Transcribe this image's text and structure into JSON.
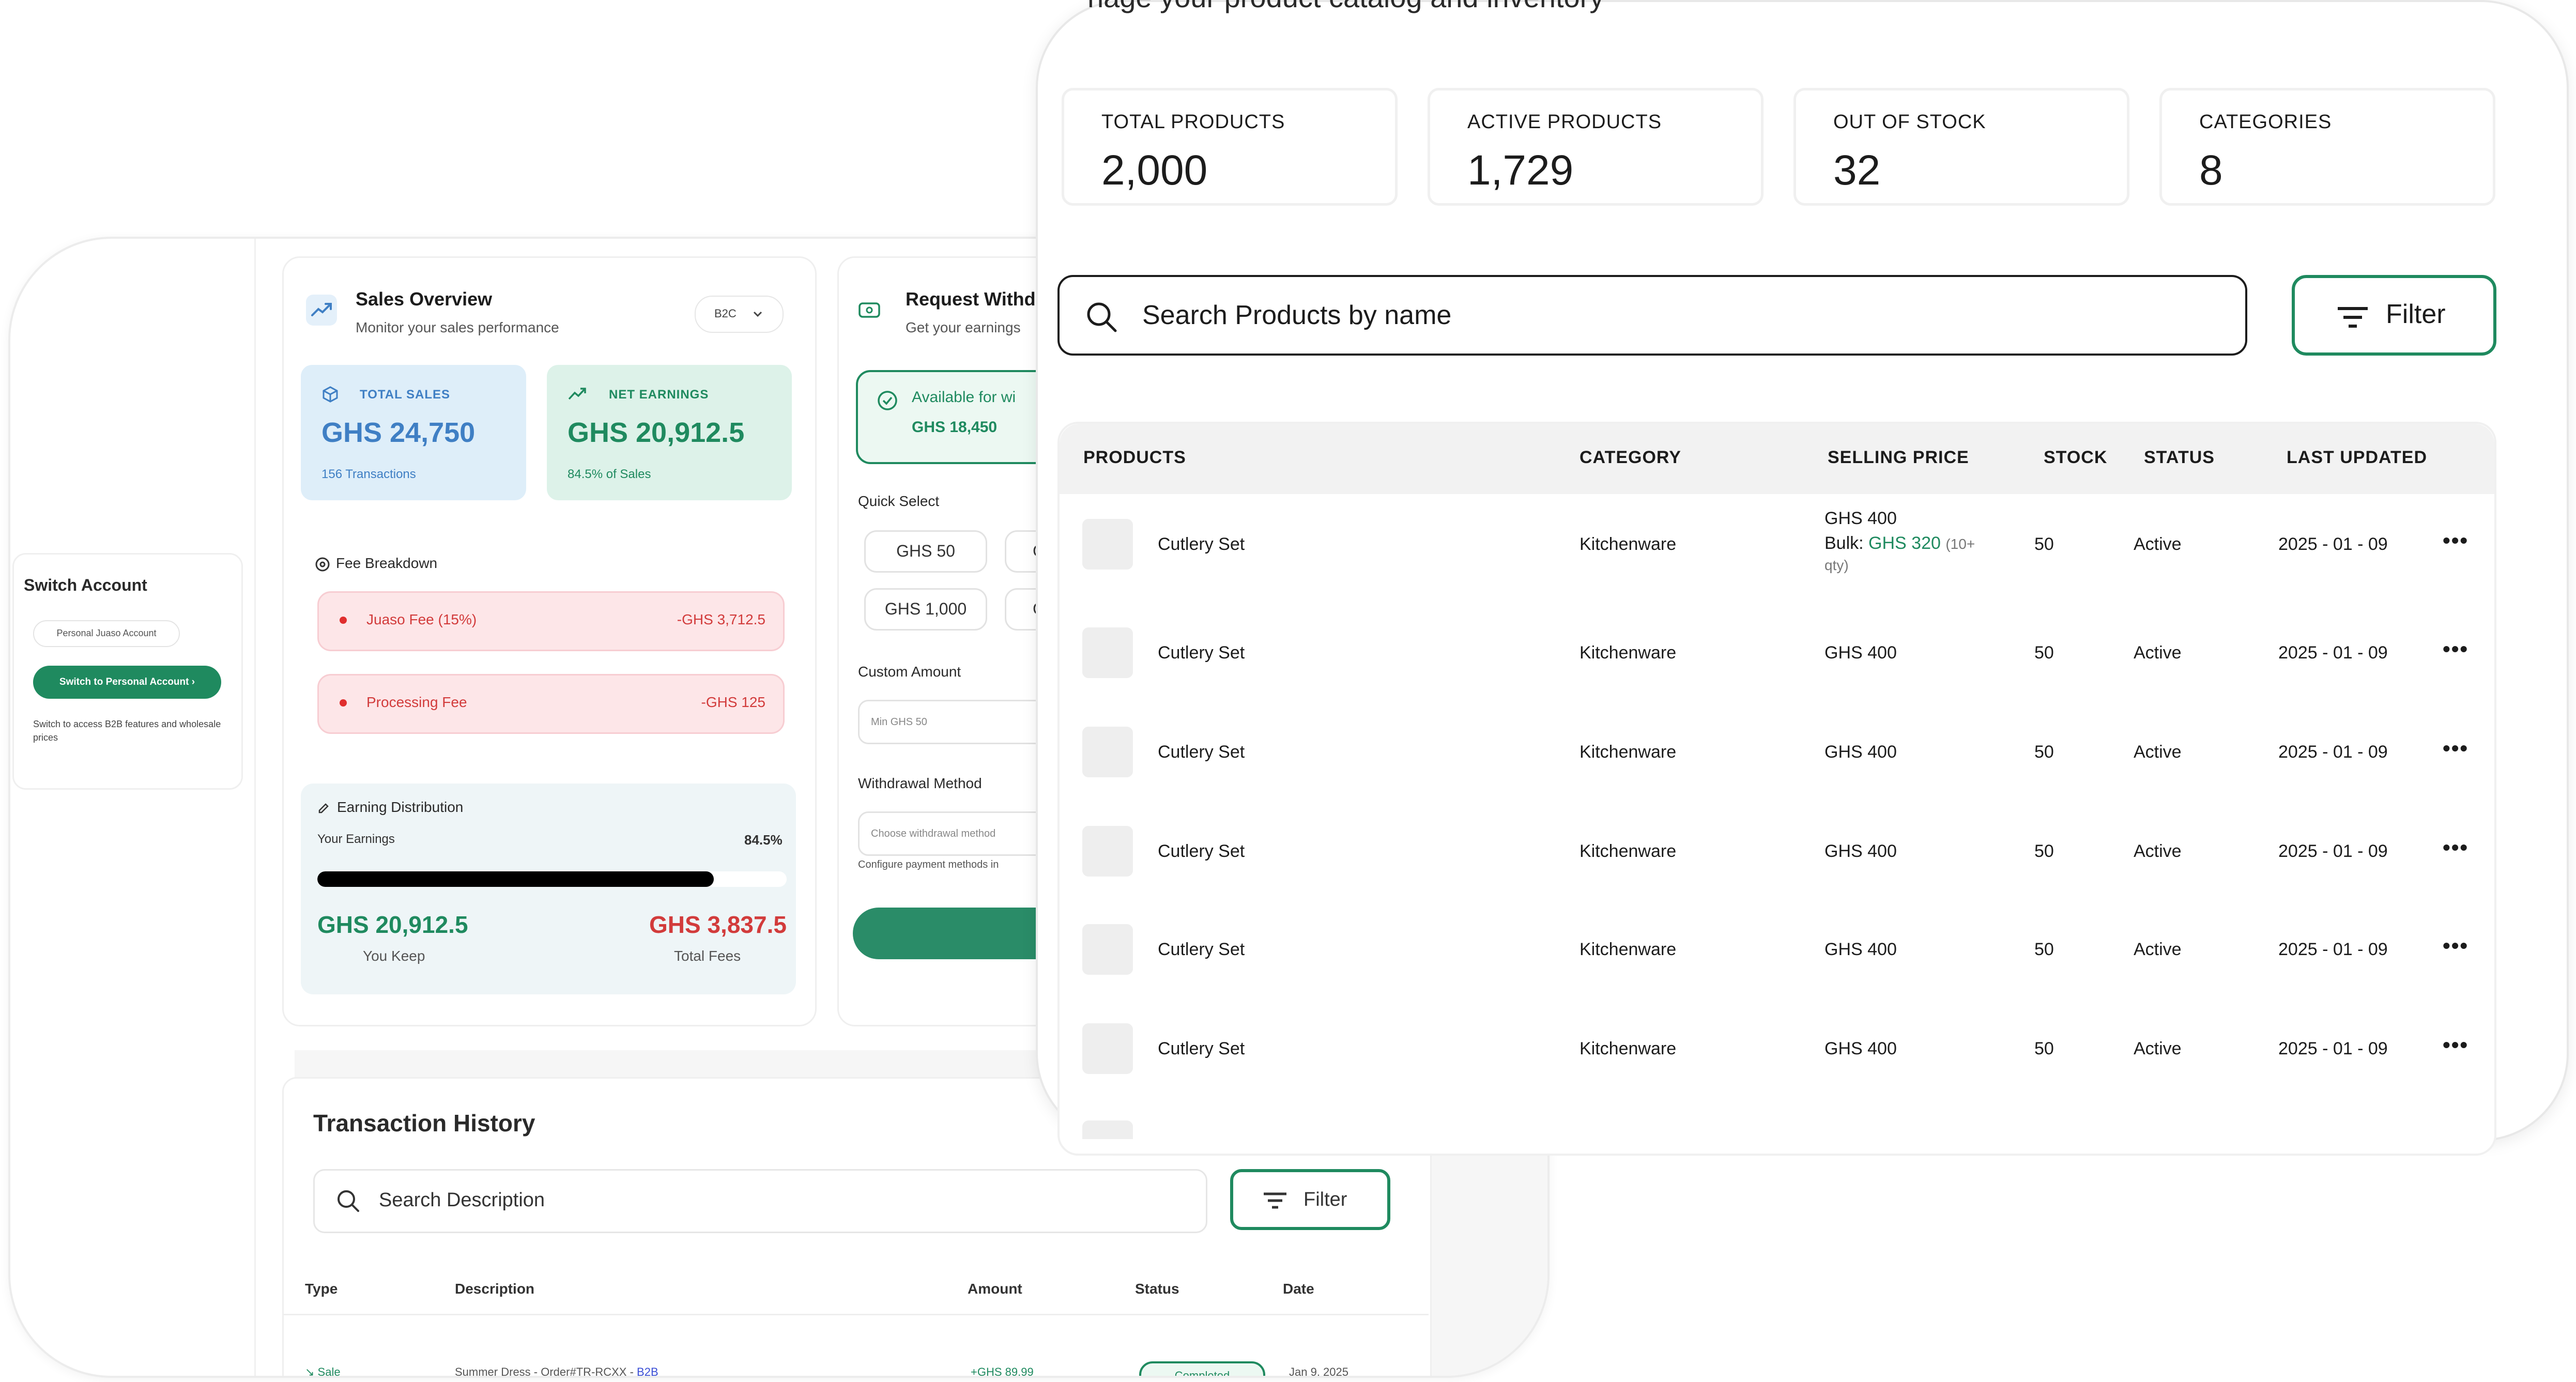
{
  "colors": {
    "brand_green": "#1f8a5f",
    "danger_red": "#d23b3b",
    "sales_blue": "#3f7fc4",
    "text_dark": "#1c1c1c"
  },
  "dashboard": {
    "switch_account": {
      "title": "Switch Account",
      "current_account": "Personal Juaso Account",
      "button_label": "Switch to Personal Account",
      "note": "Switch to access B2B features and wholesale prices"
    },
    "sales_overview": {
      "title": "Sales Overview",
      "subtitle": "Monitor your sales performance",
      "channel_select": "B2C",
      "total_sales": {
        "label": "TOTAL SALES",
        "value": "GHS 24,750",
        "sub": "156 Transactions"
      },
      "net_earnings": {
        "label": "NET EARNINGS",
        "value": "GHS 20,912.5",
        "sub": "84.5% of Sales"
      },
      "fee_breakdown": {
        "title": "Fee Breakdown",
        "items": [
          {
            "name": "Juaso Fee (15%)",
            "amount": "-GHS 3,712.5"
          },
          {
            "name": "Processing Fee",
            "amount": "-GHS 125"
          }
        ]
      },
      "earning_distribution": {
        "title": "Earning Distribution",
        "your_earnings_label": "Your Earnings",
        "percent_label": "84.5%",
        "percent_value": 84.5,
        "keep_value": "GHS 20,912.5",
        "keep_label": "You Keep",
        "fees_value": "GHS 3,837.5",
        "fees_label": "Total Fees"
      }
    },
    "withdraw": {
      "title": "Request Withd",
      "subtitle": "Get your earnings",
      "available_label": "Available for wi",
      "available_value": "GHS 18,450",
      "quick_select_title": "Quick Select",
      "quick_amounts": [
        "GHS 50",
        "GH",
        "GHS 1,000",
        "GH"
      ],
      "custom_amount_title": "Custom Amount",
      "custom_amount_placeholder": "Min GHS 50",
      "method_title": "Withdrawal Method",
      "method_placeholder": "Choose withdrawal method",
      "method_note": "Configure payment methods in"
    },
    "transaction_history": {
      "title": "Transaction History",
      "search_placeholder": "Search Description",
      "filter_label": "Filter",
      "columns": [
        "Type",
        "Description",
        "Amount",
        "Status",
        "Date"
      ],
      "rows": [
        {
          "type": "Sale",
          "description": "Summer Dress - Order#TR-RCXX - ",
          "channel": "B2B",
          "amount": "+GHS 89.99",
          "status": "Completed",
          "date": "Jan 9, 2025"
        }
      ]
    }
  },
  "catalog": {
    "page_subtitle": "nage your product catalog and inventory",
    "stats": [
      {
        "label": "TOTAL PRODUCTS",
        "value": "2,000"
      },
      {
        "label": "ACTIVE PRODUCTS",
        "value": "1,729"
      },
      {
        "label": "OUT OF STOCK",
        "value": "32"
      },
      {
        "label": "CATEGORIES",
        "value": "8"
      }
    ],
    "search_placeholder": "Search Products by name",
    "filter_label": "Filter",
    "columns": [
      "PRODUCTS",
      "CATEGORY",
      "SELLING PRICE",
      "STOCK",
      "STATUS",
      "LAST UPDATED"
    ],
    "bulk": {
      "label": "Bulk: ",
      "price": "GHS 320",
      "note": "(10+",
      "note2": "qty)"
    },
    "rows": [
      {
        "name": "Cutlery Set",
        "category": "Kitchenware",
        "price": "GHS 400",
        "stock": "50",
        "status": "Active",
        "updated": "2025 - 01 - 09"
      },
      {
        "name": "Cutlery Set",
        "category": "Kitchenware",
        "price": "GHS 400",
        "stock": "50",
        "status": "Active",
        "updated": "2025 - 01 - 09"
      },
      {
        "name": "Cutlery Set",
        "category": "Kitchenware",
        "price": "GHS 400",
        "stock": "50",
        "status": "Active",
        "updated": "2025 - 01 - 09"
      },
      {
        "name": "Cutlery Set",
        "category": "Kitchenware",
        "price": "GHS 400",
        "stock": "50",
        "status": "Active",
        "updated": "2025 - 01 - 09"
      },
      {
        "name": "Cutlery Set",
        "category": "Kitchenware",
        "price": "GHS 400",
        "stock": "50",
        "status": "Active",
        "updated": "2025 - 01 - 09"
      },
      {
        "name": "Cutlery Set",
        "category": "Kitchenware",
        "price": "GHS 400",
        "stock": "50",
        "status": "Active",
        "updated": "2025 - 01 - 09"
      }
    ],
    "more_icon": "more-horizontal-icon"
  }
}
